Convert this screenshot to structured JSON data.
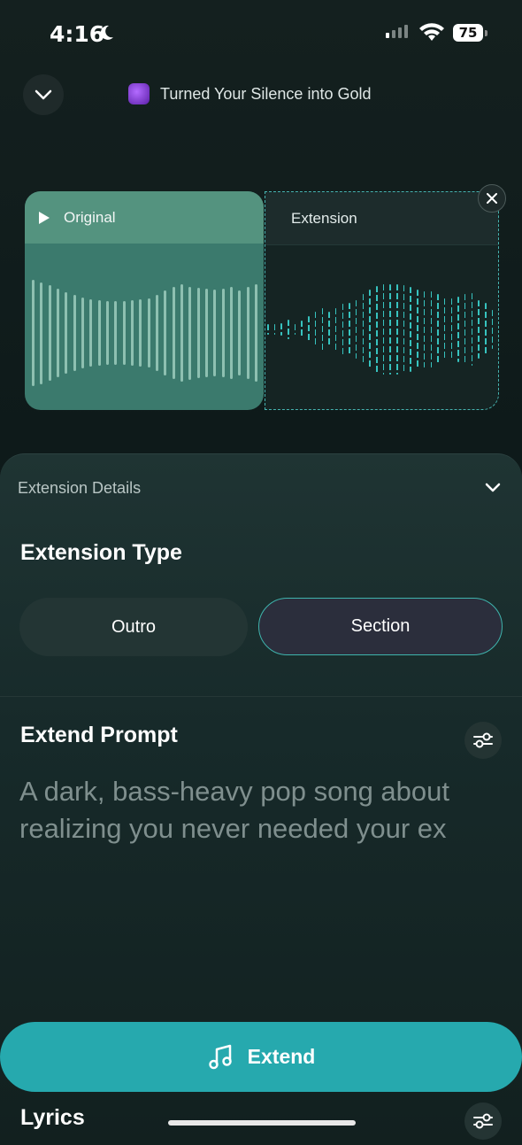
{
  "status_bar": {
    "time": "4:16",
    "battery": "75"
  },
  "header": {
    "title": "Turned Your Silence into Gold"
  },
  "cards": {
    "original_label": "Original",
    "extension_label": "Extension"
  },
  "details": {
    "section_label": "Extension Details",
    "type_title": "Extension Type",
    "options": [
      "Outro",
      "Section"
    ],
    "selected_option": "Section",
    "prompt_title": "Extend Prompt",
    "prompt_text": "A dark, bass-heavy pop song about realizing you never needed your ex"
  },
  "actions": {
    "extend_label": "Extend"
  },
  "lyrics": {
    "title": "Lyrics"
  },
  "colors": {
    "accent": "#26a9ae",
    "original_card": "#3b7a6d",
    "extension_wave": "#37c3bf"
  },
  "icons": [
    "moon-icon",
    "signal-icon",
    "wifi-icon",
    "battery-icon",
    "chevron-down-icon",
    "play-icon",
    "close-icon",
    "settings-sliders-icon",
    "music-note-icon"
  ]
}
